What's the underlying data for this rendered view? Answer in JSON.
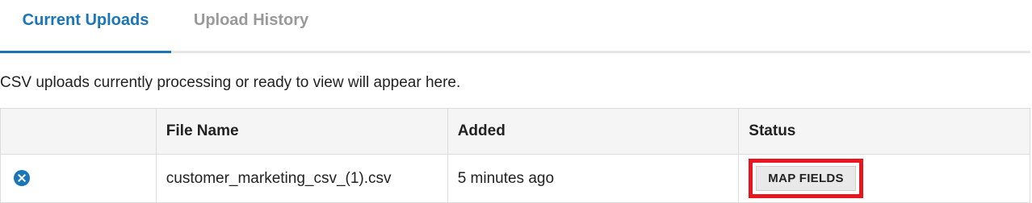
{
  "tabs": [
    {
      "label": "Current Uploads",
      "active": true
    },
    {
      "label": "Upload History",
      "active": false
    }
  ],
  "description": "CSV uploads currently processing or ready to view will appear here.",
  "table": {
    "headers": [
      "",
      "File Name",
      "Added",
      "Status"
    ],
    "rows": [
      {
        "remove_icon": "remove-circle-icon",
        "file_name": "customer_marketing_csv_(1).csv",
        "added": "5 minutes ago",
        "status_button": "MAP FIELDS"
      }
    ]
  },
  "colors": {
    "accent": "#1a76b8",
    "highlight": "#e8171f",
    "inactive_tab": "#999999"
  }
}
